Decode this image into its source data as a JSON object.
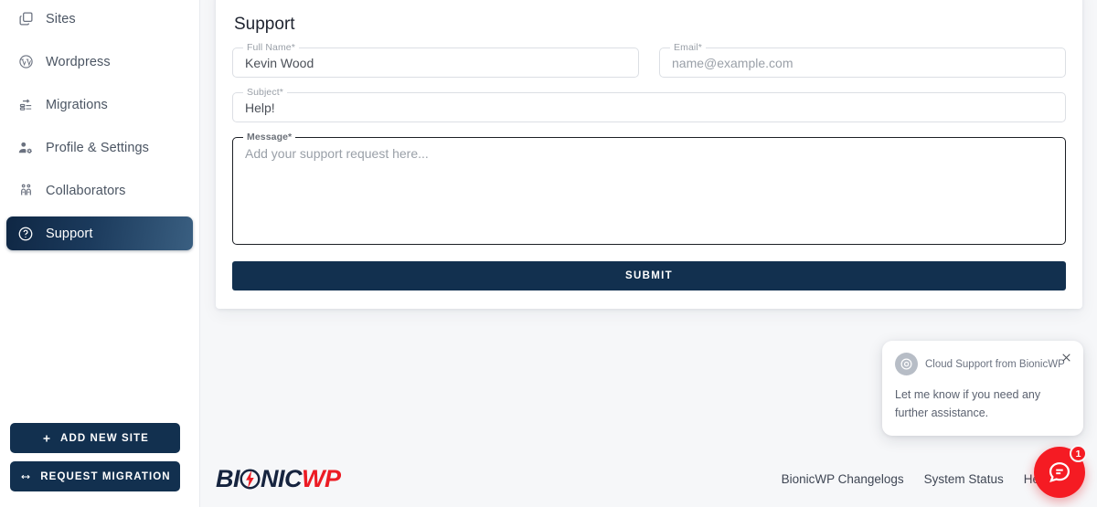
{
  "sidebar": {
    "items": [
      {
        "label": "Sites",
        "icon": "sites-icon",
        "active": false
      },
      {
        "label": "Wordpress",
        "icon": "wordpress-icon",
        "active": false
      },
      {
        "label": "Migrations",
        "icon": "migrations-icon",
        "active": false
      },
      {
        "label": "Profile & Settings",
        "icon": "profile-settings-icon",
        "active": false
      },
      {
        "label": "Collaborators",
        "icon": "collaborators-icon",
        "active": false
      },
      {
        "label": "Support",
        "icon": "support-icon",
        "active": true
      }
    ],
    "add_site_label": "ADD NEW SITE",
    "add_site_icon": "plus-icon",
    "request_migration_label": "REQUEST MIGRATION",
    "request_migration_icon": "arrows-horizontal-icon"
  },
  "support_form": {
    "title": "Support",
    "full_name": {
      "label": "Full Name*",
      "value": "Kevin Wood",
      "placeholder": "Full Name"
    },
    "email": {
      "label": "Email*",
      "value": "",
      "placeholder": "name@example.com"
    },
    "subject": {
      "label": "Subject*",
      "value": "Help!",
      "placeholder": "Subject"
    },
    "message": {
      "label": "Message*",
      "value": "",
      "placeholder": "Add your support request here..."
    },
    "submit_label": "SUBMIT"
  },
  "footer": {
    "logo": {
      "part1": "BI",
      "bolt": "O",
      "part2": "NIC",
      "part3": "WP"
    },
    "links": [
      "BionicWP Changelogs",
      "System Status",
      "Help Docs"
    ]
  },
  "chat": {
    "from": "Cloud Support from BionicWP",
    "message": "Let me know if you need any further assistance.",
    "badge_count": "1",
    "close_icon": "close-icon",
    "avatar_icon": "chat-avatar-icon",
    "launcher_icon": "chat-bubble-icon"
  },
  "colors": {
    "navy": "#12304f",
    "red": "#f51b23",
    "page_bg": "#f6f7f9"
  }
}
